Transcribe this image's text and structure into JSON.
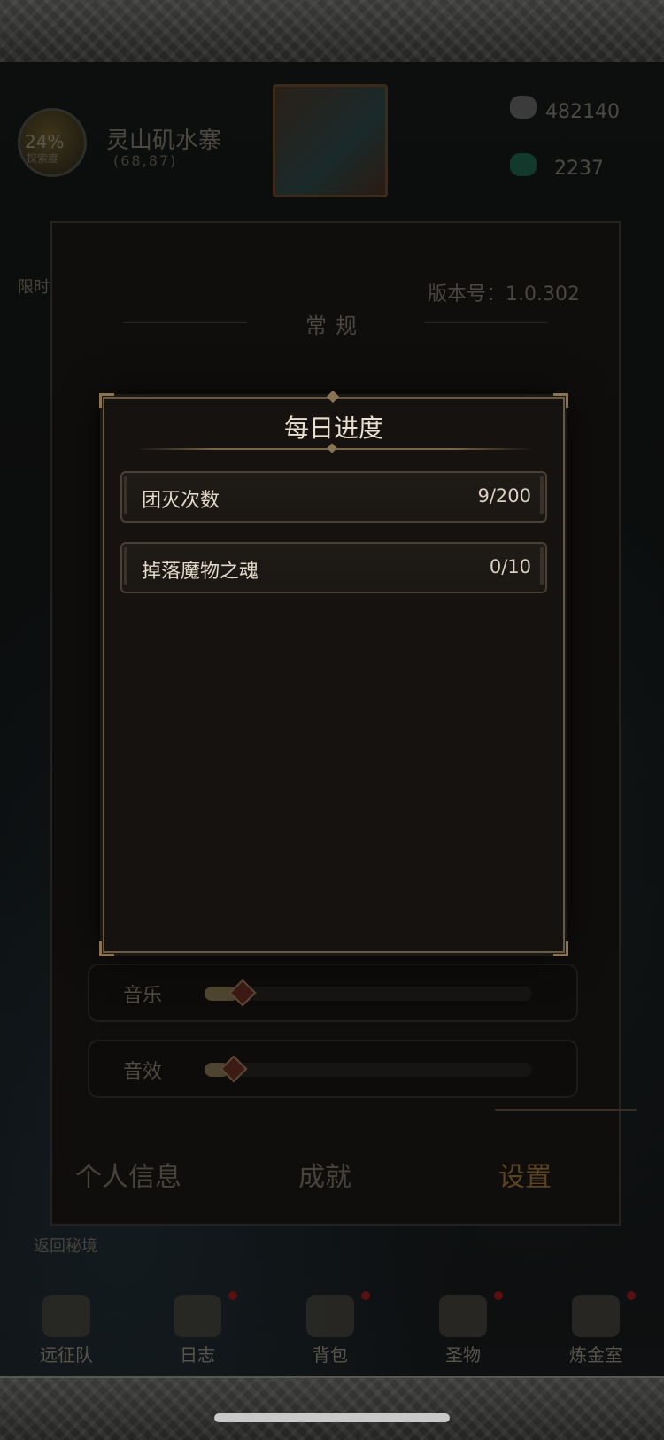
{
  "hud": {
    "progress_pct": "24%",
    "progress_sub": "探索度",
    "location_name": "灵山矶水寨",
    "location_coords": "(68,87)",
    "currency_1": "482140",
    "currency_2": "2237",
    "limited_label": "限时",
    "return_link": "返回秘境"
  },
  "settings_panel": {
    "version": "版本号：1.0.302",
    "section_general": "常规",
    "sliders": [
      {
        "label": "音乐",
        "value": 0.1
      },
      {
        "label": "音效",
        "value": 0.08
      }
    ],
    "tabs": [
      "个人信息",
      "成就",
      "设置"
    ],
    "active_tab": "设置"
  },
  "modal": {
    "title": "每日进度",
    "rows": [
      {
        "name": "团灭次数",
        "value": "9/200"
      },
      {
        "name": "掉落魔物之魂",
        "value": "0/10"
      }
    ]
  },
  "bottom_nav": [
    "远征队",
    "日志",
    "背包",
    "圣物",
    "炼金室"
  ]
}
